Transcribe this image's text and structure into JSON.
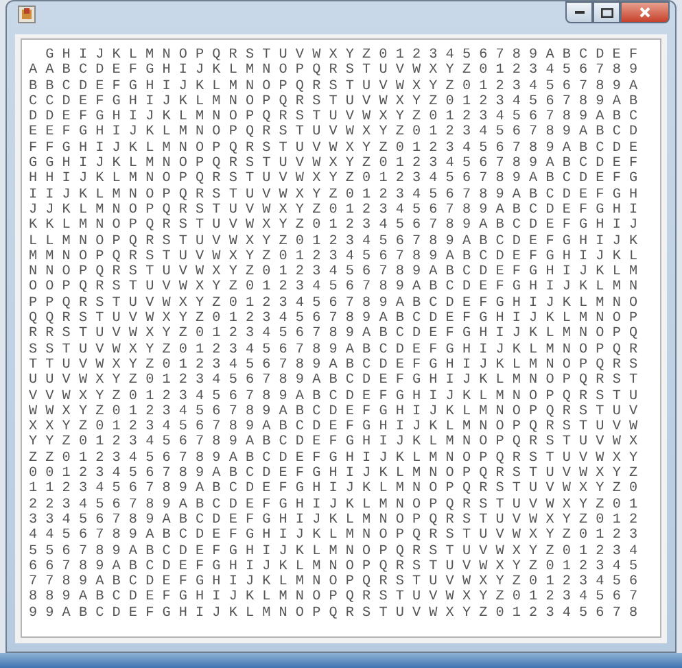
{
  "table": {
    "header": "G H I J K L M N O P Q R S T U V W X Y Z 0 1 2 3 4 5 6 7 8 9 A B C D E F",
    "rows": [
      "A A B C D E F G H I J K L M N O P Q R S T U V W X Y Z 0 1 2 3 4 5 6 7 8 9",
      "B B C D E F G H I J K L M N O P Q R S T U V W X Y Z 0 1 2 3 4 5 6 7 8 9 A",
      "C C D E F G H I J K L M N O P Q R S T U V W X Y Z 0 1 2 3 4 5 6 7 8 9 A B",
      "D D E F G H I J K L M N O P Q R S T U V W X Y Z 0 1 2 3 4 5 6 7 8 9 A B C",
      "E E F G H I J K L M N O P Q R S T U V W X Y Z 0 1 2 3 4 5 6 7 8 9 A B C D",
      "F F G H I J K L M N O P Q R S T U V W X Y Z 0 1 2 3 4 5 6 7 8 9 A B C D E",
      "G G H I J K L M N O P Q R S T U V W X Y Z 0 1 2 3 4 5 6 7 8 9 A B C D E F",
      "H H I J K L M N O P Q R S T U V W X Y Z 0 1 2 3 4 5 6 7 8 9 A B C D E F G",
      "I I J K L M N O P Q R S T U V W X Y Z 0 1 2 3 4 5 6 7 8 9 A B C D E F G H",
      "J J K L M N O P Q R S T U V W X Y Z 0 1 2 3 4 5 6 7 8 9 A B C D E F G H I",
      "K K L M N O P Q R S T U V W X Y Z 0 1 2 3 4 5 6 7 8 9 A B C D E F G H I J",
      "L L M N O P Q R S T U V W X Y Z 0 1 2 3 4 5 6 7 8 9 A B C D E F G H I J K",
      "M M N O P Q R S T U V W X Y Z 0 1 2 3 4 5 6 7 8 9 A B C D E F G H I J K L",
      "N N O P Q R S T U V W X Y Z 0 1 2 3 4 5 6 7 8 9 A B C D E F G H I J K L M",
      "O O P Q R S T U V W X Y Z 0 1 2 3 4 5 6 7 8 9 A B C D E F G H I J K L M N",
      "P P Q R S T U V W X Y Z 0 1 2 3 4 5 6 7 8 9 A B C D E F G H I J K L M N O",
      "Q Q R S T U V W X Y Z 0 1 2 3 4 5 6 7 8 9 A B C D E F G H I J K L M N O P",
      "R R S T U V W X Y Z 0 1 2 3 4 5 6 7 8 9 A B C D E F G H I J K L M N O P Q",
      "S S T U V W X Y Z 0 1 2 3 4 5 6 7 8 9 A B C D E F G H I J K L M N O P Q R",
      "T T U V W X Y Z 0 1 2 3 4 5 6 7 8 9 A B C D E F G H I J K L M N O P Q R S",
      "U U V W X Y Z 0 1 2 3 4 5 6 7 8 9 A B C D E F G H I J K L M N O P Q R S T",
      "V V W X Y Z 0 1 2 3 4 5 6 7 8 9 A B C D E F G H I J K L M N O P Q R S T U",
      "W W X Y Z 0 1 2 3 4 5 6 7 8 9 A B C D E F G H I J K L M N O P Q R S T U V",
      "X X Y Z 0 1 2 3 4 5 6 7 8 9 A B C D E F G H I J K L M N O P Q R S T U V W",
      "Y Y Z 0 1 2 3 4 5 6 7 8 9 A B C D E F G H I J K L M N O P Q R S T U V W X",
      "Z Z 0 1 2 3 4 5 6 7 8 9 A B C D E F G H I J K L M N O P Q R S T U V W X Y",
      "0 0 1 2 3 4 5 6 7 8 9 A B C D E F G H I J K L M N O P Q R S T U V W X Y Z",
      "1 1 2 3 4 5 6 7 8 9 A B C D E F G H I J K L M N O P Q R S T U V W X Y Z 0",
      "2 2 3 4 5 6 7 8 9 A B C D E F G H I J K L M N O P Q R S T U V W X Y Z 0 1",
      "3 3 4 5 6 7 8 9 A B C D E F G H I J K L M N O P Q R S T U V W X Y Z 0 1 2",
      "4 4 5 6 7 8 9 A B C D E F G H I J K L M N O P Q R S T U V W X Y Z 0 1 2 3",
      "5 5 6 7 8 9 A B C D E F G H I J K L M N O P Q R S T U V W X Y Z 0 1 2 3 4",
      "6 6 7 8 9 A B C D E F G H I J K L M N O P Q R S T U V W X Y Z 0 1 2 3 4 5",
      "7 7 8 9 A B C D E F G H I J K L M N O P Q R S T U V W X Y Z 0 1 2 3 4 5 6",
      "8 8 9 A B C D E F G H I J K L M N O P Q R S T U V W X Y Z 0 1 2 3 4 5 6 7",
      "9 9 A B C D E F G H I J K L M N O P Q R S T U V W X Y Z 0 1 2 3 4 5 6 7 8"
    ]
  }
}
